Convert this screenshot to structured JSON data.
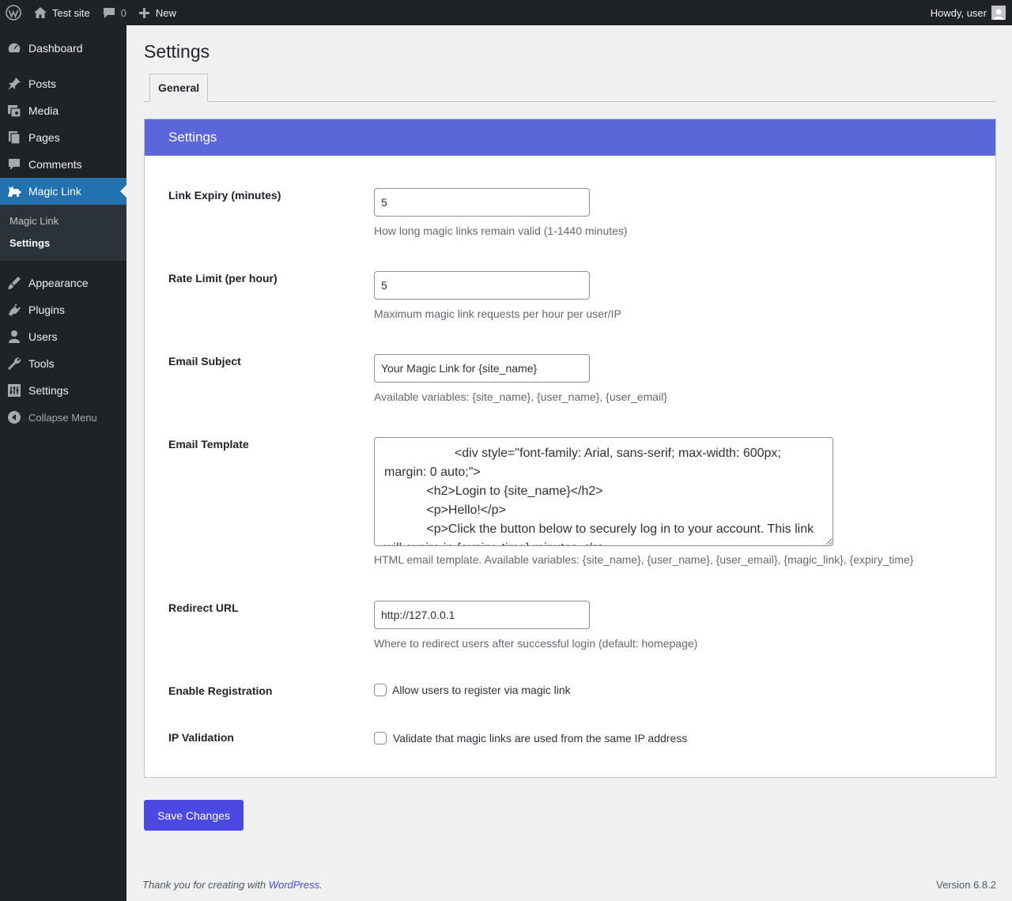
{
  "adminbar": {
    "logo_icon": "wordpress-logo-icon",
    "site_name": "Test site",
    "comments_count": "0",
    "new_label": "New",
    "greeting": "Howdy, user"
  },
  "sidebar": {
    "items": [
      {
        "label": "Dashboard",
        "icon": "dashboard-icon"
      },
      {
        "label": "Posts",
        "icon": "pushpin-icon"
      },
      {
        "label": "Media",
        "icon": "media-icon"
      },
      {
        "label": "Pages",
        "icon": "pages-icon"
      },
      {
        "label": "Comments",
        "icon": "comment-icon"
      },
      {
        "label": "Magic Link",
        "icon": "magic-link-icon"
      },
      {
        "label": "Appearance",
        "icon": "paintbrush-icon"
      },
      {
        "label": "Plugins",
        "icon": "plug-icon"
      },
      {
        "label": "Users",
        "icon": "user-icon"
      },
      {
        "label": "Tools",
        "icon": "wrench-icon"
      },
      {
        "label": "Settings",
        "icon": "settings-sliders-icon"
      }
    ],
    "submenu": [
      "Magic Link",
      "Settings"
    ],
    "collapse_label": "Collapse Menu"
  },
  "page": {
    "title": "Settings",
    "tab_label": "General",
    "panel_title": "Settings"
  },
  "fields": {
    "link_expiry": {
      "label": "Link Expiry (minutes)",
      "value": "5",
      "description": "How long magic links remain valid (1-1440 minutes)"
    },
    "rate_limit": {
      "label": "Rate Limit (per hour)",
      "value": "5",
      "description": "Maximum magic link requests per hour per user/IP"
    },
    "email_subject": {
      "label": "Email Subject",
      "value": "Your Magic Link for {site_name}",
      "description": "Available variables: {site_name}, {user_name}, {user_email}"
    },
    "email_template": {
      "label": "Email Template",
      "value": "                    <div style=\"font-family: Arial, sans-serif; max-width: 600px; margin: 0 auto;\">\n            <h2>Login to {site_name}</h2>\n            <p>Hello!</p>\n            <p>Click the button below to securely log in to your account. This link will expire in {expiry_time} minutes.</p>",
      "description": "HTML email template. Available variables: {site_name}, {user_name}, {user_email}, {magic_link}, {expiry_time}"
    },
    "redirect_url": {
      "label": "Redirect URL",
      "value": "http://127.0.0.1",
      "description": "Where to redirect users after successful login (default: homepage)"
    },
    "enable_registration": {
      "label": "Enable Registration",
      "checkbox_label": "Allow users to register via magic link",
      "checked": false
    },
    "ip_validation": {
      "label": "IP Validation",
      "checkbox_label": "Validate that magic links are used from the same IP address",
      "checked": false
    }
  },
  "save_label": "Save Changes",
  "footer": {
    "thanks_prefix": "Thank you for creating with ",
    "thanks_link": "WordPress",
    "thanks_suffix": ".",
    "version": "Version 6.8.2"
  },
  "colors": {
    "admin_dark": "#1d2327",
    "current_menu": "#2271b1",
    "panel_header": "#5b66d9",
    "primary_button": "#4b48e3"
  }
}
